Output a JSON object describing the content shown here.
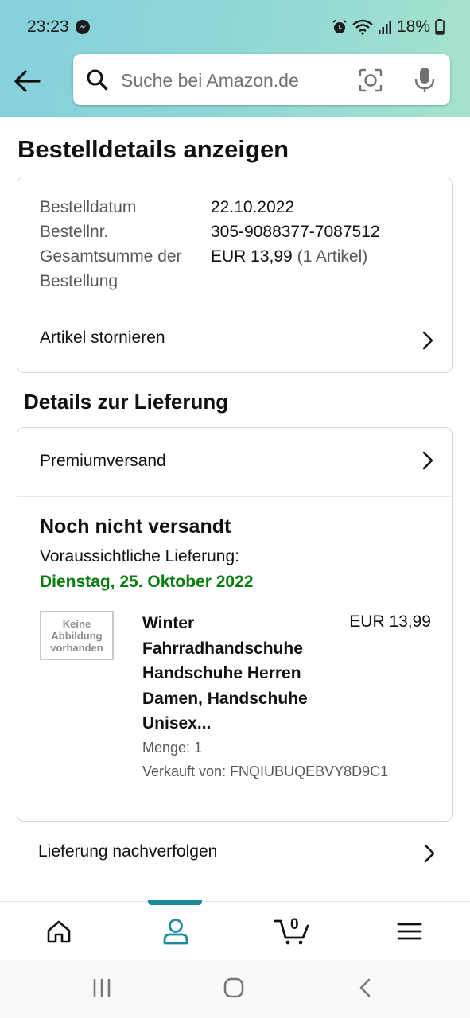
{
  "status_bar": {
    "time": "23:23",
    "battery": "18%"
  },
  "search": {
    "placeholder": "Suche bei Amazon.de"
  },
  "page": {
    "title": "Bestelldetails anzeigen"
  },
  "order": {
    "date_label": "Bestelldatum",
    "date_value": "22.10.2022",
    "number_label": "Bestellnr.",
    "number_value": "305-9088377-7087512",
    "total_label": "Gesamtsumme der Bestellung",
    "total_value": "EUR 13,99",
    "total_items": "(1 Artikel)",
    "cancel_label": "Artikel stornieren"
  },
  "delivery": {
    "section_title": "Details zur Lieferung",
    "shipping_method": "Premiumversand",
    "state": "Noch nicht versandt",
    "expected_label": "Voraussichtliche Lieferung:",
    "expected_date": "Dienstag, 25. Oktober 2022",
    "no_image_text": [
      "Keine",
      "Abbildung",
      "vorhanden"
    ],
    "product_name": "Winter Fahrradhandschuhe Handschuhe Herren Damen, Handschuhe Unisex...",
    "price": "EUR 13,99",
    "quantity": "Menge: 1",
    "seller": "Verkauft von: FNQIUBUQEBVY8D9C1",
    "track_label": "Lieferung nachverfolgen"
  },
  "bottom_nav": {
    "cart_count": "0",
    "active": "account"
  },
  "colors": {
    "header_gradient_start": "#84d0dc",
    "header_gradient_end": "#a5e3cd",
    "delivery_green": "#067d0b",
    "active_teal": "#1b8a9a"
  },
  "icons": [
    "back-arrow-icon",
    "search-icon",
    "camera-icon",
    "microphone-icon",
    "chevron-right-icon",
    "home-icon",
    "account-icon",
    "cart-icon",
    "menu-icon"
  ]
}
